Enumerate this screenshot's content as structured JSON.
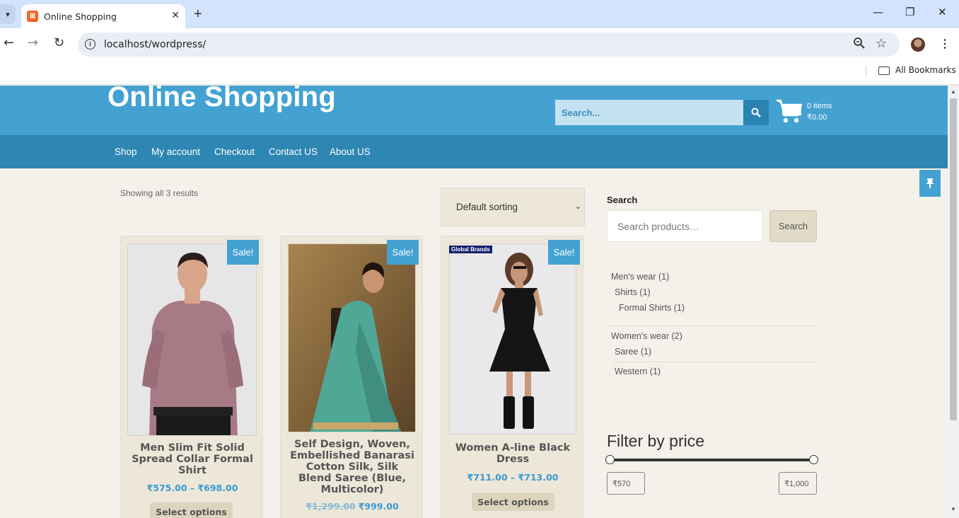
{
  "browser": {
    "tab_title": "Online Shopping",
    "url": "localhost/wordpress/",
    "bookmarks_label": "All Bookmarks"
  },
  "site": {
    "title": "Online Shopping",
    "search_placeholder": "Search...",
    "cart_items": "0 items",
    "cart_total": "₹0.00"
  },
  "nav": [
    "Shop",
    "My account",
    "Checkout",
    "Contact US",
    "About US"
  ],
  "shop": {
    "result_count": "Showing all 3 results",
    "sort_selected": "Default sorting",
    "sale_label": "Sale!",
    "brand_badge": "Global Brands",
    "products": [
      {
        "name": "Men Slim Fit Solid Spread Collar Formal Shirt",
        "price": "₹575.00 – ₹698.00",
        "button": "Select options"
      },
      {
        "name": "Self Design, Woven, Embellished Banarasi Cotton Silk, Silk Blend Saree (Blue, Multicolor)",
        "old_price": "₹1,299.00",
        "price": "₹999.00",
        "button": ""
      },
      {
        "name": "Women A-line Black Dress",
        "price": "₹711.00 – ₹713.00",
        "button": "Select options"
      }
    ]
  },
  "sidebar": {
    "search_heading": "Search",
    "search_placeholder": "Search products…",
    "search_button": "Search",
    "categories": {
      "mens": "Men's wear (1)",
      "shirts": "Shirts (1)",
      "formal_shirts": "Formal Shirts (1)",
      "womens": "Women's wear (2)",
      "saree": "Saree (1)",
      "western": "Western (1)"
    },
    "filter_title": "Filter by price",
    "price_min": "₹570",
    "price_max": "₹1,000"
  },
  "colors": {
    "header_blue": "#43a2d2",
    "nav_blue": "#2e86b2",
    "page_bg": "#f4f1ea",
    "price_blue": "#3a9ad1"
  }
}
